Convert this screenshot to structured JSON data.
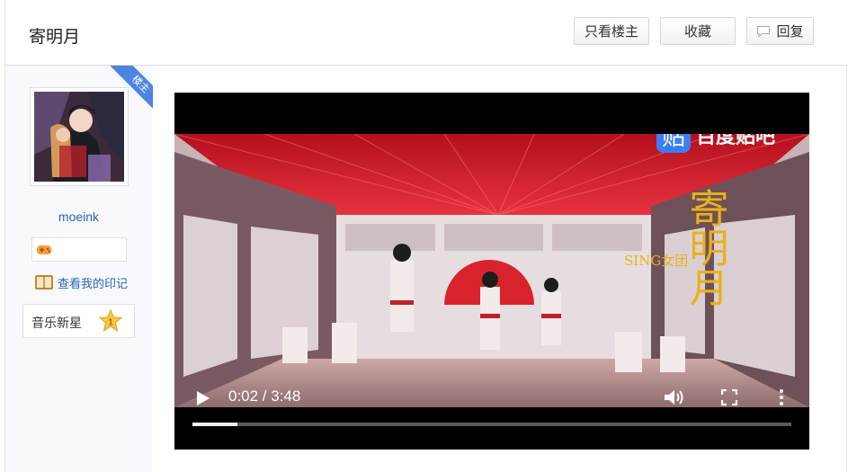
{
  "post": {
    "title": "寄明月"
  },
  "toolbar": {
    "only_op_label": "只看楼主",
    "favorite_label": "收藏",
    "reply_label": "回复",
    "reply_icon": "speech-bubble-icon"
  },
  "author": {
    "op_badge": "楼主",
    "username": "moeink",
    "view_marks_label": "查看我的印记",
    "level_name": "音乐新星",
    "level_number": "1"
  },
  "video": {
    "watermark_brand_glyph": "贴",
    "watermark_brand_text": "百度贴吧",
    "title_overlay": "寄明月",
    "group_label": "SING女团",
    "time_display": "0:02 / 3:48",
    "progress_played": 0.01,
    "progress_buffered": 0.075
  },
  "colors": {
    "link_blue": "#2d64b3",
    "op_ribbon": "#4b84e3",
    "baidu_blue": "#3d7df7",
    "title_gold": "#e8b21c"
  }
}
